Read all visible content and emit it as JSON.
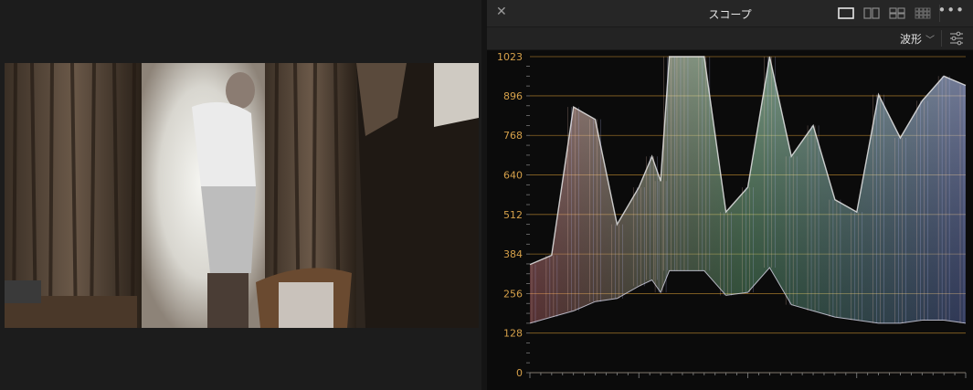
{
  "viewer": {
    "image_description_icon": "film-frame"
  },
  "scopes_panel": {
    "title": "スコープ",
    "close_icon": "close-icon",
    "layouts": [
      "single-layout-icon",
      "dual-layout-icon",
      "quad-layout-icon",
      "grid-layout-icon"
    ],
    "more_icon": "more-icon",
    "scope_type": "波形",
    "settings_icon": "settings-icon"
  },
  "colors": {
    "accent_gridline": "#b8862f",
    "tick_label": "#d5a04a",
    "panel_bg": "#262626",
    "plot_bg": "#0b0b0b"
  },
  "chart_data": {
    "type": "area",
    "title": "",
    "xlabel": "",
    "ylabel": "",
    "ylim": [
      0,
      1023
    ],
    "yticks": [
      "1023",
      "896",
      "768",
      "640",
      "512",
      "384",
      "256",
      "128",
      "0"
    ],
    "grid": true,
    "x": [
      0,
      0.05,
      0.1,
      0.15,
      0.2,
      0.25,
      0.28,
      0.3,
      0.32,
      0.35,
      0.4,
      0.45,
      0.5,
      0.55,
      0.6,
      0.65,
      0.7,
      0.75,
      0.8,
      0.85,
      0.9,
      0.95,
      1.0
    ],
    "series": [
      {
        "values": [
          350,
          380,
          860,
          820,
          480,
          600,
          700,
          620,
          1023,
          1023,
          1023,
          520,
          600,
          1023,
          700,
          800,
          560,
          520,
          900,
          760,
          880,
          960,
          930
        ]
      },
      {
        "values": [
          160,
          180,
          200,
          230,
          240,
          280,
          300,
          260,
          330,
          330,
          330,
          250,
          260,
          340,
          220,
          200,
          180,
          170,
          160,
          160,
          170,
          170,
          160
        ]
      }
    ]
  }
}
